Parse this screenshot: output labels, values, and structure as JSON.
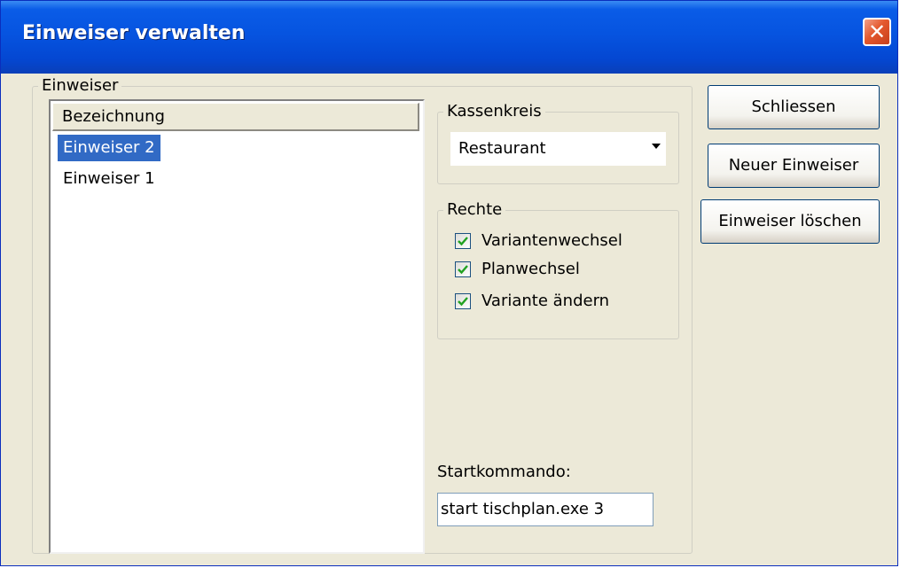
{
  "window": {
    "title": "Einweiser verwalten",
    "close_glyph": "✕",
    "close_icon": "close-icon"
  },
  "einweiser_group": {
    "legend": "Einweiser",
    "column_header": "Bezeichnung",
    "items": [
      {
        "label": "Einweiser 2",
        "selected": true
      },
      {
        "label": "Einweiser 1",
        "selected": false
      }
    ]
  },
  "kassenkreis": {
    "legend": "Kassenkreis",
    "selected": "Restaurant"
  },
  "rechte": {
    "legend": "Rechte",
    "items": [
      {
        "label": "Variantenwechsel",
        "checked": true
      },
      {
        "label": "Planwechsel",
        "checked": true
      },
      {
        "label": "Variante ändern",
        "checked": true
      }
    ]
  },
  "startkommando": {
    "label": "Startkommando:",
    "value": "start tischplan.exe 3"
  },
  "buttons": {
    "close": "Schliessen",
    "new": "Neuer Einweiser",
    "delete": "Einweiser löschen"
  },
  "colors": {
    "titlebar": "#0654e0",
    "dialog_bg": "#ece9d8",
    "selection": "#316ac5"
  }
}
